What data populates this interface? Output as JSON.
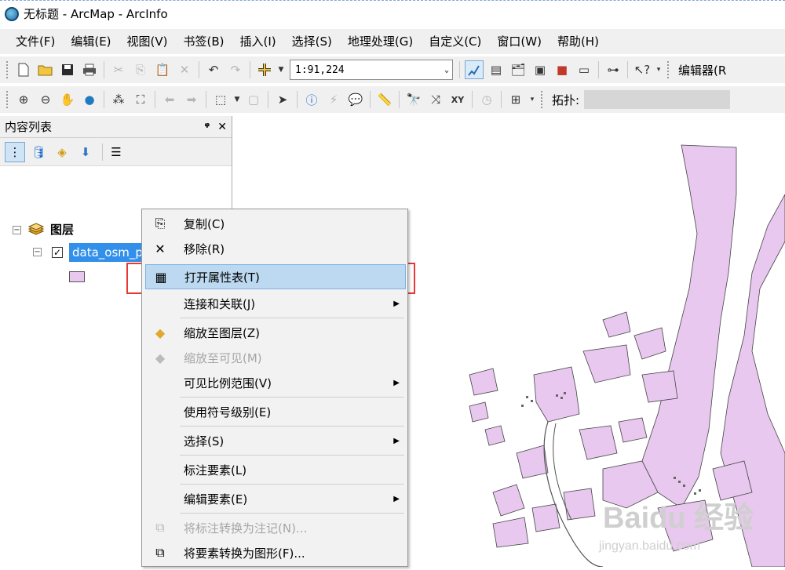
{
  "window": {
    "title": "无标题 - ArcMap - ArcInfo"
  },
  "menubar": [
    {
      "label": "文件(F)"
    },
    {
      "label": "编辑(E)"
    },
    {
      "label": "视图(V)"
    },
    {
      "label": "书签(B)"
    },
    {
      "label": "插入(I)"
    },
    {
      "label": "选择(S)"
    },
    {
      "label": "地理处理(G)"
    },
    {
      "label": "自定义(C)"
    },
    {
      "label": "窗口(W)"
    },
    {
      "label": "帮助(H)"
    }
  ],
  "toolbar": {
    "scale_value": "1:91,224",
    "editor_label": "编辑器(R",
    "topology_label": "拓扑:"
  },
  "toc": {
    "title": "内容列表",
    "pin_symbol": "ᵠ",
    "close_symbol": "✕",
    "root_label": "图层",
    "layer_name": "data_osm_ply",
    "layer_checked": true,
    "swatch_color": "#e8c8ef"
  },
  "context_menu": {
    "items": [
      {
        "label": "复制(C)",
        "icon": "copy-icon",
        "enabled": true,
        "submenu": false
      },
      {
        "label": "移除(R)",
        "icon": "remove-icon",
        "enabled": true,
        "submenu": false
      },
      {
        "label": "打开属性表(T)",
        "icon": "table-icon",
        "enabled": true,
        "submenu": false,
        "highlighted": true
      },
      {
        "label": "连接和关联(J)",
        "icon": "",
        "enabled": true,
        "submenu": true
      },
      {
        "label": "缩放至图层(Z)",
        "icon": "zoom-layer-icon",
        "enabled": true,
        "submenu": false
      },
      {
        "label": "缩放至可见(M)",
        "icon": "zoom-visible-icon",
        "enabled": false,
        "submenu": false
      },
      {
        "label": "可见比例范围(V)",
        "icon": "",
        "enabled": true,
        "submenu": true
      },
      {
        "label": "使用符号级别(E)",
        "icon": "",
        "enabled": true,
        "submenu": false
      },
      {
        "label": "选择(S)",
        "icon": "",
        "enabled": true,
        "submenu": true
      },
      {
        "label": "标注要素(L)",
        "icon": "",
        "enabled": true,
        "submenu": false
      },
      {
        "label": "编辑要素(E)",
        "icon": "",
        "enabled": true,
        "submenu": true
      },
      {
        "label": "将标注转换为注记(N)...",
        "icon": "convert-labels-icon",
        "enabled": false,
        "submenu": false
      },
      {
        "label": "将要素转换为图形(F)...",
        "icon": "convert-features-icon",
        "enabled": true,
        "submenu": false
      }
    ]
  },
  "watermark": {
    "line1": "Baidu 经验",
    "line2": "jingyan.baidu.com"
  },
  "colors": {
    "highlight": "#bcd9f1",
    "callout": "#e53935",
    "polygon_fill": "#e8c8ef",
    "selection": "#3390ea"
  }
}
